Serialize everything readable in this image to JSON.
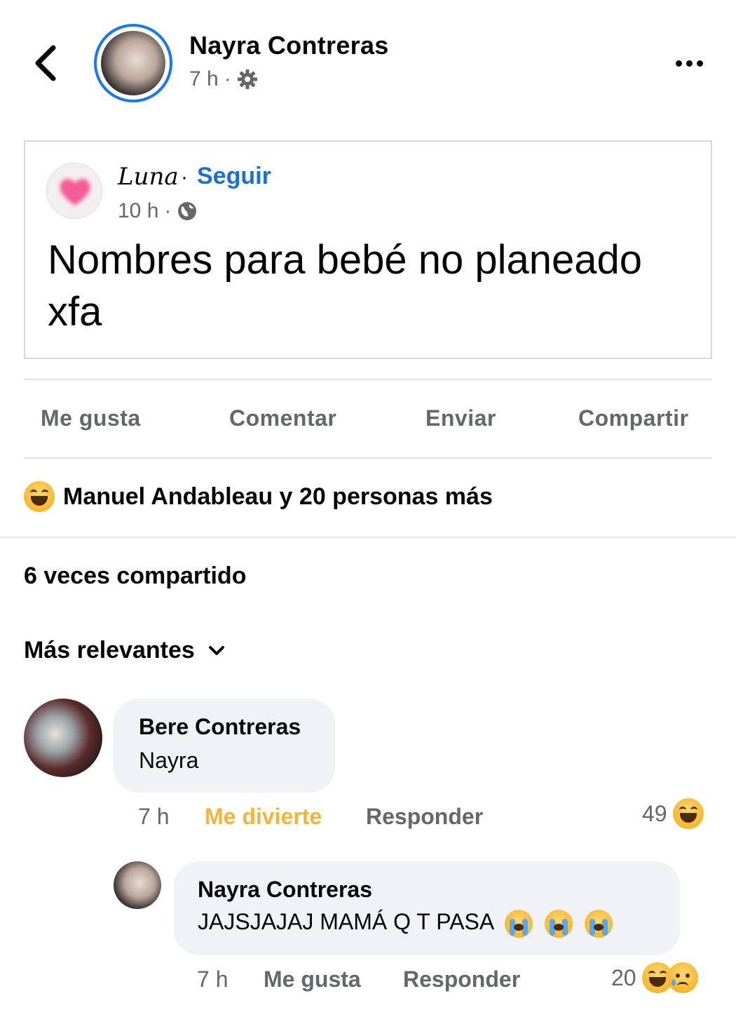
{
  "post": {
    "author_name": "Nayra Contreras",
    "time": "7 h",
    "privacy_icon": "gear-icon",
    "shared": {
      "author_name": "Luna",
      "separator": "·",
      "follow_label": "Seguir",
      "time": "10 h",
      "privacy_icon": "globe-icon",
      "text": "Nombres para bebé no planeado xfa"
    }
  },
  "actions": {
    "like": "Me gusta",
    "comment": "Comentar",
    "send": "Enviar",
    "share": "Compartir"
  },
  "reactions_summary": "Manuel Andableau y 20 personas más",
  "shares_count": "6 veces compartido",
  "sort_label": "Más relevantes",
  "comments": [
    {
      "author": "Bere Contreras",
      "text": "Nayra",
      "time": "7 h",
      "reaction_label": "Me divierte",
      "reply_label": "Responder",
      "reaction_count": "49",
      "reaction_color": "#f2b43a"
    },
    {
      "author": "Nayra Contreras",
      "text": "JAJSJAJAJ MAMÁ Q T PASA",
      "time": "7 h",
      "reaction_label": "Me gusta",
      "reply_label": "Responder",
      "reaction_count": "20"
    }
  ],
  "colors": {
    "accent": "#1877f2",
    "link": "#1d6fd8",
    "muted_text": "#65676b",
    "bubble_bg": "#f0f2f5"
  }
}
